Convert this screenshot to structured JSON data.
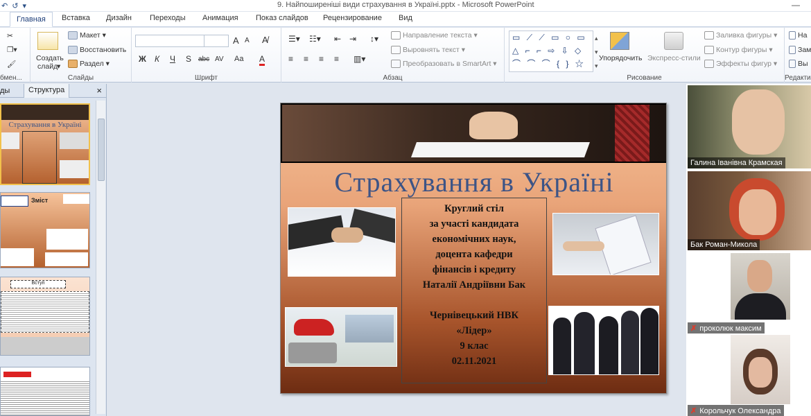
{
  "window": {
    "title": "9. Найпоширеніші види страхування в Україні.pptx - Microsoft PowerPoint",
    "qat_undo": "↶",
    "qat_redo": "↺",
    "minimize": "—"
  },
  "ribbon_tabs": [
    "Главная",
    "Вставка",
    "Дизайн",
    "Переходы",
    "Анимация",
    "Показ слайдов",
    "Рецензирование",
    "Вид"
  ],
  "ribbon": {
    "clipboard_label": "бмен...",
    "slides": {
      "create_slide": "Создать",
      "create_slide2": "слайд",
      "layout": "Макет",
      "reset": "Восстановить",
      "section": "Раздел",
      "label": "Слайды"
    },
    "font": {
      "bold": "Ж",
      "italic": "К",
      "underline": "Ч",
      "shadow": "S",
      "strike": "abc",
      "spacing": "AV",
      "case": "Aa",
      "color": "A",
      "grow": "A",
      "shrink": "A",
      "label": "Шрифт"
    },
    "paragraph": {
      "text_direction": "Направление текста",
      "align_text": "Выровнять текст",
      "smartart": "Преобразовать в SmartArt",
      "label": "Абзац"
    },
    "drawing": {
      "arrange": "Упорядочить",
      "quick_styles": "Экспресс-стили",
      "shape_fill": "Заливка фигуры",
      "shape_outline": "Контур фигуры",
      "shape_effects": "Эффекты фигур",
      "label": "Рисование"
    },
    "editing": {
      "find": "На",
      "replace": "Зам",
      "select": "Вы",
      "label": "Редакти"
    }
  },
  "left_panel": {
    "tab_slides": "ды",
    "tab_outline": "Структура",
    "close": "×",
    "thumb1_title": "Страхування в Україні",
    "thumb2_title": "Зміст",
    "thumb3_title": "Вступ"
  },
  "slide": {
    "title": "Страхування в Україні",
    "center_lines": [
      "Круглий стіл",
      "за участі кандидата",
      "економічних наук,",
      "доцента кафедри",
      "фінансів і кредиту",
      "Наталії  Андріївни Бак",
      "",
      "Чернівецький НВК",
      "«Лідер»",
      "9 клас",
      "02.11.2021"
    ]
  },
  "participants": [
    {
      "name": "Галина Іванівна Крамская",
      "muted": false
    },
    {
      "name": "Бак Роман-Микола",
      "muted": false
    },
    {
      "name": "проколюк максим",
      "muted": true
    },
    {
      "name": "Корольчук Олександра",
      "muted": true
    }
  ],
  "colors": {
    "slide_title": "#3d5486",
    "ribbon_accent": "#1f3f7a",
    "muted_mic": "#e03b2a"
  }
}
